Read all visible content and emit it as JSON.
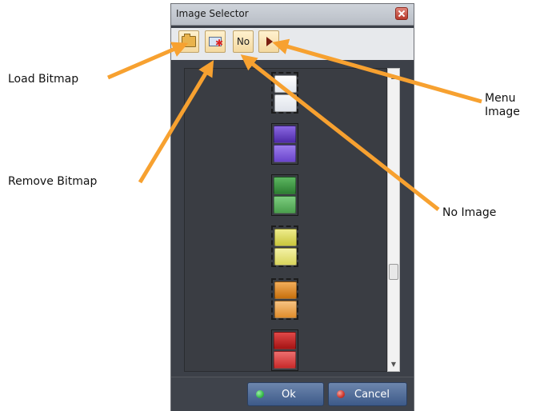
{
  "dialog": {
    "title": "Image Selector",
    "toolbar": {
      "no_label": "No"
    },
    "swatches": [
      {
        "name": "white",
        "top": "#ffffff",
        "bottom": "#f0f2f5",
        "dashed": true
      },
      {
        "name": "purple",
        "top": "#6a43c8",
        "bottom": "#8d6ae0",
        "dashed": false
      },
      {
        "name": "green",
        "top": "#3f9d43",
        "bottom": "#69c06b",
        "dashed": false
      },
      {
        "name": "yellow",
        "top": "#d8d65a",
        "bottom": "#ecea8c",
        "dashed": true
      },
      {
        "name": "orange",
        "top": "#e08a24",
        "bottom": "#f2b064",
        "dashed": true
      },
      {
        "name": "red",
        "top": "#c42222",
        "bottom": "#e05a5a",
        "dashed": false
      }
    ],
    "buttons": {
      "ok_label": "Ok",
      "cancel_label": "Cancel",
      "ok_dot_color": "#3cc050",
      "cancel_dot_color": "#d23c32"
    }
  },
  "annotations": {
    "load_bitmap": "Load Bitmap",
    "remove_bitmap": "Remove Bitmap",
    "menu_image_line1": "Menu",
    "menu_image_line2": "Image",
    "no_image": "No Image",
    "arrow_color": "#f7a130"
  }
}
